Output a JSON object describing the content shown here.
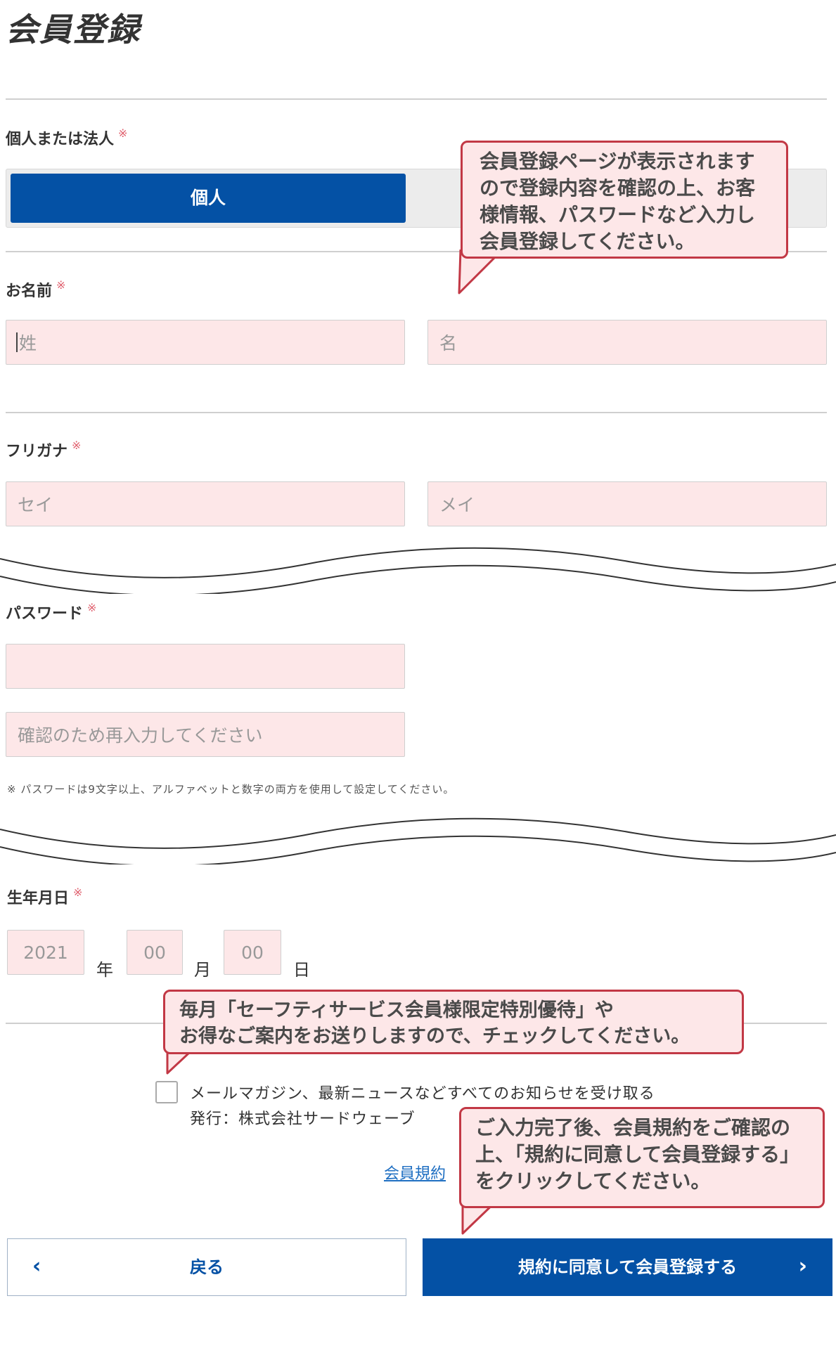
{
  "page": {
    "title": "会員登録"
  },
  "fields": {
    "type": {
      "label": "個人または法人",
      "required_mark": "※",
      "selected_option": "個人"
    },
    "name": {
      "label": "お名前",
      "required_mark": "※",
      "last_placeholder": "姓",
      "first_placeholder": "名"
    },
    "furigana": {
      "label": "フリガナ",
      "required_mark": "※",
      "last_placeholder": "セイ",
      "first_placeholder": "メイ"
    },
    "password": {
      "label": "パスワード",
      "required_mark": "※",
      "value": "",
      "confirm_placeholder": "確認のため再入力してください",
      "note": "※ パスワードは9文字以上、アルファベットと数字の両方を使用して設定してください。"
    },
    "birthday": {
      "label": "生年月日",
      "required_mark": "※",
      "year_value": "2021",
      "year_unit": "年",
      "month_value": "00",
      "month_unit": "月",
      "day_value": "00",
      "day_unit": "日"
    }
  },
  "newsletter": {
    "checked": false,
    "label": "メールマガジン、最新ニュースなどすべてのお知らせを受け取る",
    "publisher": "発行：株式会社サードウェーブ"
  },
  "terms_link": "会員規約",
  "buttons": {
    "back_label": "戻る",
    "back_chevron": "‹",
    "submit_label": "規約に同意して会員登録する",
    "submit_chevron": "›"
  },
  "callouts": {
    "top": [
      "会員登録ページが表示されます",
      "ので登録内容を確認の上、お客",
      "様情報、パスワードなど入力し",
      "会員登録してください。"
    ],
    "newsletter": [
      "毎月「セーフティサービス会員様限定特別優待」や",
      "お得なご案内をお送りしますので、チェックしてください。"
    ],
    "submit": [
      "ご入力完了後、会員規約をご確認の",
      "上、「規約に同意して会員登録する」",
      "をクリックしてください。"
    ]
  },
  "colors": {
    "primary": "#0451a5",
    "input_bg": "#fde7e8",
    "callout_border": "#c23845",
    "required": "#e0606e",
    "link": "#1f6fc2"
  }
}
